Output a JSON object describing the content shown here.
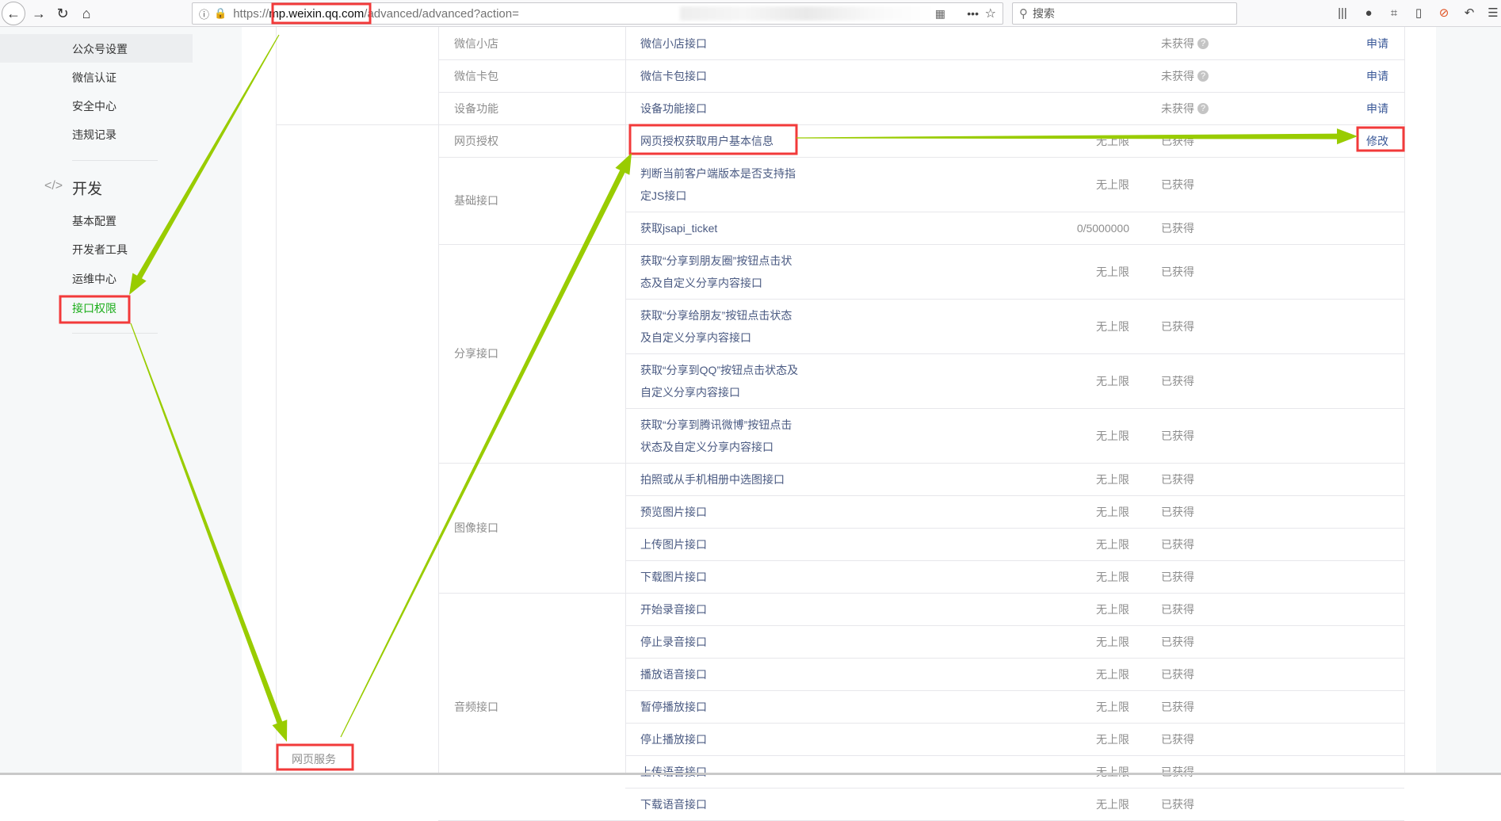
{
  "browser": {
    "url_protocol": "https://",
    "url_host": "mp.weixin.qq.com",
    "url_path": "/advanced/advanced?action=",
    "search_placeholder": "搜索"
  },
  "sidebar": {
    "items_top": [
      {
        "label": "公众号设置",
        "active": true
      },
      {
        "label": "微信认证"
      },
      {
        "label": "安全中心"
      },
      {
        "label": "违规记录"
      }
    ],
    "dev_section": {
      "title": "开发",
      "icon": "code-icon"
    },
    "items_dev": [
      {
        "label": "基本配置"
      },
      {
        "label": "开发者工具"
      },
      {
        "label": "运维中心"
      },
      {
        "label": "接口权限",
        "selected": true
      }
    ]
  },
  "table": {
    "section_label": "网页服务",
    "groups": [
      {
        "category": "微信小店",
        "rows": [
          {
            "name": "微信小店接口",
            "limit": "",
            "status": "未获得",
            "help": true,
            "action": "申请"
          }
        ]
      },
      {
        "category": "微信卡包",
        "rows": [
          {
            "name": "微信卡包接口",
            "limit": "",
            "status": "未获得",
            "help": true,
            "action": "申请"
          }
        ]
      },
      {
        "category": "设备功能",
        "rows": [
          {
            "name": "设备功能接口",
            "limit": "",
            "status": "未获得",
            "help": true,
            "action": "申请"
          }
        ]
      },
      {
        "category": "网页授权",
        "rows": [
          {
            "name": "网页授权获取用户基本信息",
            "limit": "无上限",
            "status": "已获得",
            "action": "修改"
          }
        ]
      },
      {
        "category": "基础接口",
        "rows": [
          {
            "name": "判断当前客户端版本是否支持指定JS接口",
            "limit": "无上限",
            "status": "已获得"
          },
          {
            "name": "获取jsapi_ticket",
            "limit": "0/5000000",
            "status": "已获得"
          }
        ]
      },
      {
        "category": "分享接口",
        "rows": [
          {
            "name": "获取“分享到朋友圈”按钮点击状态及自定义分享内容接口",
            "limit": "无上限",
            "status": "已获得"
          },
          {
            "name": "获取“分享给朋友”按钮点击状态及自定义分享内容接口",
            "limit": "无上限",
            "status": "已获得"
          },
          {
            "name": "获取“分享到QQ”按钮点击状态及自定义分享内容接口",
            "limit": "无上限",
            "status": "已获得"
          },
          {
            "name": "获取“分享到腾讯微博”按钮点击状态及自定义分享内容接口",
            "limit": "无上限",
            "status": "已获得"
          }
        ]
      },
      {
        "category": "图像接口",
        "rows": [
          {
            "name": "拍照或从手机相册中选图接口",
            "limit": "无上限",
            "status": "已获得"
          },
          {
            "name": "预览图片接口",
            "limit": "无上限",
            "status": "已获得"
          },
          {
            "name": "上传图片接口",
            "limit": "无上限",
            "status": "已获得"
          },
          {
            "name": "下载图片接口",
            "limit": "无上限",
            "status": "已获得"
          }
        ]
      },
      {
        "category": "音频接口",
        "rows": [
          {
            "name": "开始录音接口",
            "limit": "无上限",
            "status": "已获得"
          },
          {
            "name": "停止录音接口",
            "limit": "无上限",
            "status": "已获得"
          },
          {
            "name": "播放语音接口",
            "limit": "无上限",
            "status": "已获得"
          },
          {
            "name": "暂停播放接口",
            "limit": "无上限",
            "status": "已获得"
          },
          {
            "name": "停止播放接口",
            "limit": "无上限",
            "status": "已获得"
          },
          {
            "name": "上传语音接口",
            "limit": "无上限",
            "status": "已获得"
          },
          {
            "name": "下载语音接口",
            "limit": "无上限",
            "status": "已获得"
          }
        ]
      }
    ]
  },
  "annotations": {
    "box_color": "#f23a3a",
    "arrow_color": "#99cc00"
  }
}
